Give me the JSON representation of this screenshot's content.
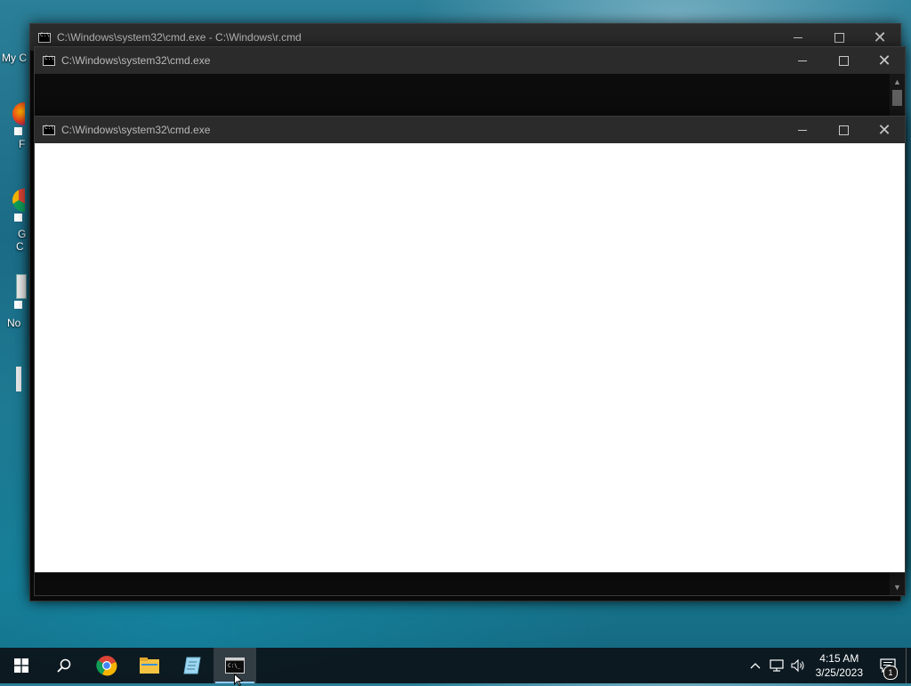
{
  "desktop": {
    "icon_labels": [
      "My C",
      "F",
      "G",
      "C",
      "No"
    ]
  },
  "windows": {
    "back": {
      "title": "C:\\Windows\\system32\\cmd.exe - C:\\Windows\\r.cmd"
    },
    "middle": {
      "title": "C:\\Windows\\system32\\cmd.exe"
    },
    "front": {
      "title": "C:\\Windows\\system32\\cmd.exe"
    },
    "controls": {
      "minimize": "minimize-icon",
      "maximize": "maximize-icon",
      "close": "close-icon"
    }
  },
  "taskbar": {
    "items": [
      "windows-start-icon",
      "search-icon",
      "chrome-icon",
      "file-explorer-icon",
      "notepad-icon",
      "command-prompt-icon"
    ],
    "active_item": "command-prompt-icon",
    "tray": {
      "time": "4:15 AM",
      "date": "3/25/2023",
      "notification_count": "1"
    }
  },
  "colors": {
    "titlebar": "#2b2b2b",
    "console_bg": "#0c0c0c",
    "front_client": "#ffffff",
    "accent": "#8fc8f0"
  }
}
